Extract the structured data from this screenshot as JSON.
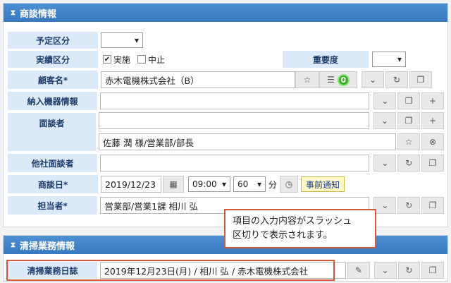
{
  "section1": {
    "title": "商談情報",
    "yotei_label": "予定区分",
    "jisseki_label": "実績区分",
    "check_jisshi": "実施",
    "check_chushi": "中止",
    "juyodo_label": "重要度",
    "kokyaku_label": "顧客名*",
    "kokyaku_value": "赤木電機株式会社（B）",
    "badge_count": "0",
    "nonyu_label": "納入機器情報",
    "mendansha_label": "面談者",
    "mendansha_value": "佐藤 潤 様/営業部/部長",
    "tasha_label": "他社面談者",
    "shodanbi_label": "商談日*",
    "date_value": "2019/12/23",
    "hour_value": "09:00",
    "minute_value": "60",
    "minute_unit": "分",
    "notice_label": "事前通知",
    "tanto_label": "担当者*",
    "tanto_value": "営業部/営業1課 相川 弘"
  },
  "tooltip": {
    "line1": "項目の入力内容がスラッシュ",
    "line2": "区切りで表示されます。"
  },
  "section2": {
    "title": "清掃業務情報",
    "nisshi_label": "清掃業務日誌",
    "nisshi_value": "2019年12月23日(月) / 相川 弘 / 赤木電機株式会社"
  }
}
